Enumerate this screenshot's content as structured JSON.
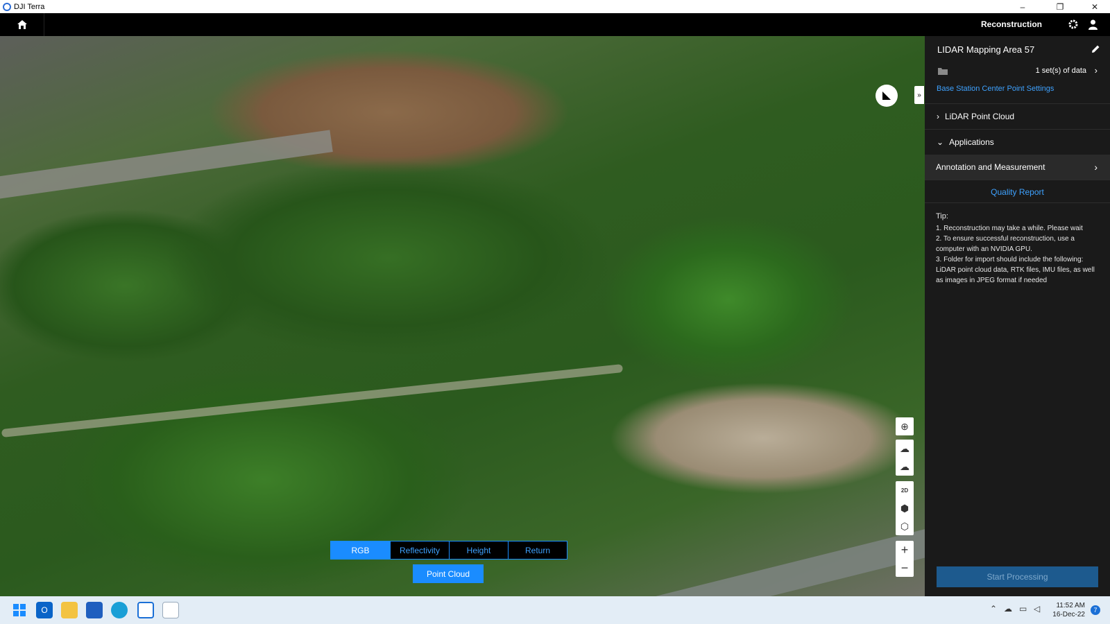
{
  "window": {
    "title": "DJI Terra",
    "minimize": "–",
    "restore": "❐",
    "close": "✕"
  },
  "topbar": {
    "mode": "Reconstruction"
  },
  "panel": {
    "project_title": "LIDAR Mapping Area 57",
    "data_sets": "1 set(s) of data",
    "base_station_link": "Base Station Center Point Settings",
    "lidar_point_cloud": "LiDAR Point Cloud",
    "applications": "Applications",
    "annotation": "Annotation and Measurement",
    "quality_report": "Quality Report",
    "tip_head": "Tip:",
    "tips": [
      "1. Reconstruction may take a while. Please wait",
      "2. To ensure successful reconstruction, use a computer with an NVIDIA GPU.",
      "3. Folder for import should include the following: LiDAR point cloud data, RTK files, IMU files, as well as images in JPEG format if needed"
    ],
    "start_button": "Start Processing"
  },
  "view_modes": {
    "rgb": "RGB",
    "reflectivity": "Reflectivity",
    "height": "Height",
    "return": "Return",
    "active": "RGB"
  },
  "point_cloud_button": "Point Cloud",
  "map_controls": {
    "view_2d": "2D",
    "zoom_in": "+",
    "zoom_out": "−"
  },
  "taskbar": {
    "time": "11:52 AM",
    "date": "16-Dec-22",
    "notifications": "7"
  },
  "colors": {
    "accent": "#1a8cff",
    "panel_bg": "#1a1a1a",
    "start_disabled": "#1d5a8e"
  }
}
